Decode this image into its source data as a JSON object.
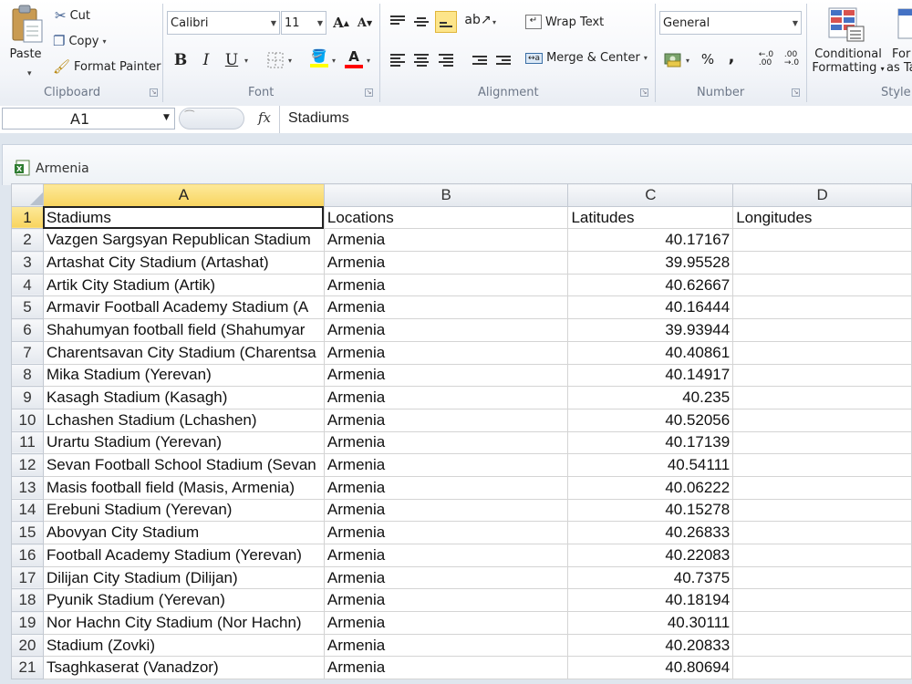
{
  "ribbon": {
    "clipboard": {
      "paste": "Paste",
      "cut": "Cut",
      "copy": "Copy",
      "format_painter": "Format Painter",
      "label": "Clipboard"
    },
    "font": {
      "name": "Calibri",
      "size": "11",
      "bold": "B",
      "italic": "I",
      "underline": "U",
      "label": "Font",
      "highlight_color": "#FFFF00",
      "font_color": "#FF0000"
    },
    "alignment": {
      "wrap_text": "Wrap Text",
      "merge_center": "Merge & Center",
      "label": "Alignment"
    },
    "number": {
      "format": "General",
      "percent": "%",
      "comma": ",",
      "label": "Number"
    },
    "styles": {
      "conditional_line1": "Conditional",
      "conditional_line2": "Formatting",
      "format_as_table_line1": "For",
      "format_as_table_line2": "as Ta",
      "label": "Style"
    }
  },
  "formula_bar": {
    "name_box": "A1",
    "fx": "fx",
    "content": "Stadiums"
  },
  "workbook": {
    "title": "Armenia"
  },
  "sheet": {
    "columns": [
      "A",
      "B",
      "C",
      "D"
    ],
    "rows": [
      {
        "n": "1",
        "a": "Stadiums",
        "b": "Locations",
        "c": "Latitudes",
        "d": "Longitudes"
      },
      {
        "n": "2",
        "a": "Vazgen Sargsyan Republican Stadium",
        "b": "Armenia",
        "c": "40.17167",
        "d": ""
      },
      {
        "n": "3",
        "a": "Artashat City Stadium (Artashat)",
        "b": "Armenia",
        "c": "39.95528",
        "d": ""
      },
      {
        "n": "4",
        "a": "Artik City Stadium (Artik)",
        "b": "Armenia",
        "c": "40.62667",
        "d": ""
      },
      {
        "n": "5",
        "a": "Armavir Football Academy Stadium (A",
        "b": "Armenia",
        "c": "40.16444",
        "d": ""
      },
      {
        "n": "6",
        "a": "Shahumyan football field (Shahumyar",
        "b": "Armenia",
        "c": "39.93944",
        "d": ""
      },
      {
        "n": "7",
        "a": "Charentsavan City Stadium (Charentsa",
        "b": "Armenia",
        "c": "40.40861",
        "d": ""
      },
      {
        "n": "8",
        "a": "Mika Stadium (Yerevan)",
        "b": "Armenia",
        "c": "40.14917",
        "d": ""
      },
      {
        "n": "9",
        "a": "Kasagh Stadium (Kasagh)",
        "b": "Armenia",
        "c": "40.235",
        "d": ""
      },
      {
        "n": "10",
        "a": "Lchashen Stadium (Lchashen)",
        "b": "Armenia",
        "c": "40.52056",
        "d": ""
      },
      {
        "n": "11",
        "a": "Urartu Stadium (Yerevan)",
        "b": "Armenia",
        "c": "40.17139",
        "d": ""
      },
      {
        "n": "12",
        "a": "Sevan Football School Stadium (Sevan",
        "b": "Armenia",
        "c": "40.54111",
        "d": ""
      },
      {
        "n": "13",
        "a": "Masis football field (Masis, Armenia)",
        "b": "Armenia",
        "c": "40.06222",
        "d": ""
      },
      {
        "n": "14",
        "a": "Erebuni Stadium (Yerevan)",
        "b": "Armenia",
        "c": "40.15278",
        "d": ""
      },
      {
        "n": "15",
        "a": "Abovyan City Stadium",
        "b": "Armenia",
        "c": "40.26833",
        "d": ""
      },
      {
        "n": "16",
        "a": "Football Academy Stadium (Yerevan)",
        "b": "Armenia",
        "c": "40.22083",
        "d": ""
      },
      {
        "n": "17",
        "a": "Dilijan City Stadium (Dilijan)",
        "b": "Armenia",
        "c": "40.7375",
        "d": ""
      },
      {
        "n": "18",
        "a": "Pyunik Stadium (Yerevan)",
        "b": "Armenia",
        "c": "40.18194",
        "d": ""
      },
      {
        "n": "19",
        "a": "Nor Hachn City Stadium (Nor Hachn)",
        "b": "Armenia",
        "c": "40.30111",
        "d": ""
      },
      {
        "n": "20",
        "a": "Stadium (Zovki)",
        "b": "Armenia",
        "c": "40.20833",
        "d": ""
      },
      {
        "n": "21",
        "a": "Tsaghkaserat (Vanadzor)",
        "b": "Armenia",
        "c": "40.80694",
        "d": ""
      }
    ]
  }
}
